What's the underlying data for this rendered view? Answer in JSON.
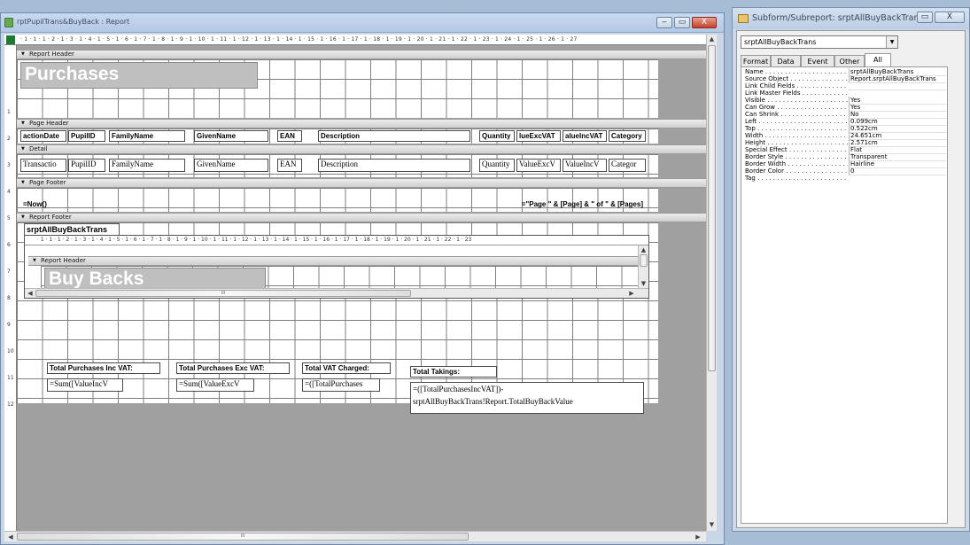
{
  "report_window": {
    "title": "rptPupilTrans&BuyBack : Report",
    "controls": {
      "minimize": "‒",
      "restore": "▭",
      "close": "X"
    },
    "ruler_ticks": "· 1 · 1 · 1 · 2 · 1 · 3 · 1 · 4 · 1 · 5 · 1 · 6 · 1 · 7 · 1 · 8 · 1 · 9 · 1 · 10 · 1 · 11 · 1 · 12 · 1 · 13 · 1 · 14 · 1 · 15 · 1 · 16 · 1 · 17 · 1 · 18 · 1 · 19 · 1 · 20 · 1 · 21 · 1 · 22 · 1 · 23 · 1 · 24 · 1 · 25 · 1 · 26 · 1 · 27",
    "sub_ruler_ticks": "· 1 · 1 · 1 · 2 · 1 · 3 · 1 · 4 · 1 · 5 · 1 · 6 · 1 · 7 · 1 · 8 · 1 · 9 · 1 · 10 · 1 · 11 · 1 · 12 · 1 · 13 · 1 · 14 · 1 · 15 · 1 · 16 · 1 · 17 · 1 · 18 · 1 · 19 · 1 · 20 · 1 · 21 · 1 · 22 · 1 · 23",
    "left_ruler": [
      "1",
      "2",
      "3",
      "4",
      "5",
      "6",
      "7",
      "8",
      "9",
      "10",
      "11",
      "12"
    ],
    "bands": {
      "report_header": "Report Header",
      "page_header": "Page Header",
      "detail": "Detail",
      "page_footer": "Page Footer",
      "report_footer": "Report Footer"
    },
    "report_header_title": "Purchases",
    "page_header_labels": [
      "actionDate",
      "PupilID",
      "FamilyName",
      "GivenName",
      "EAN",
      "Description",
      "Quantity",
      "lueExcVAT",
      "alueIncVAT",
      "Category"
    ],
    "detail_fields": [
      "Transactio",
      "PupilID",
      "FamilyName",
      "GivenName",
      "EAN",
      "Description",
      "Quantity",
      "ValueExcV",
      "ValueIncV",
      "Categor"
    ],
    "page_footer": {
      "left": "=Now()",
      "right": "=\"Page \" & [Page] & \" of \" & [Pages]"
    },
    "subreport": {
      "name": "srptAllBuyBackTrans",
      "band": "Report Header",
      "title": "Buy Backs",
      "hscroll_marker": "III"
    },
    "footer_labels": {
      "inc_vat": "Total Purchases Inc VAT:",
      "exc_vat": "Total Purchases Exc VAT:",
      "vat": "Total VAT Charged:",
      "takings": "Total Takings:"
    },
    "footer_fields": {
      "inc_vat": "=Sum([ValueIncV",
      "exc_vat": "=Sum([ValueExcV",
      "vat": "=([TotalPurchases",
      "takings_line1": "=([TotalPurchasesIncVAT])-",
      "takings_line2": "srptAllBuyBackTrans!Report.TotalBuyBackValue"
    },
    "hscroll_marker": "III"
  },
  "property_sheet": {
    "title": "Subform/Subreport: srptAllBuyBackTrans",
    "controls": {
      "restore": "▭",
      "close": "X"
    },
    "object": "srptAllBuyBackTrans",
    "tabs": [
      "Format",
      "Data",
      "Event",
      "Other",
      "All"
    ],
    "active_tab": "All",
    "properties": [
      {
        "name": "Name",
        "value": "srptAllBuyBackTrans"
      },
      {
        "name": "Source Object",
        "value": "Report.srptAllBuyBackTrans"
      },
      {
        "name": "Link Child Fields",
        "value": ""
      },
      {
        "name": "Link Master Fields",
        "value": ""
      },
      {
        "name": "Visible",
        "value": "Yes"
      },
      {
        "name": "Can Grow",
        "value": "Yes"
      },
      {
        "name": "Can Shrink",
        "value": "No"
      },
      {
        "name": "Left",
        "value": "0.099cm"
      },
      {
        "name": "Top",
        "value": "0.522cm"
      },
      {
        "name": "Width",
        "value": "24.651cm"
      },
      {
        "name": "Height",
        "value": "2.571cm"
      },
      {
        "name": "Special Effect",
        "value": "Flat"
      },
      {
        "name": "Border Style",
        "value": "Transparent"
      },
      {
        "name": "Border Width",
        "value": "Hairline"
      },
      {
        "name": "Border Color",
        "value": "0"
      },
      {
        "name": "Tag",
        "value": ""
      }
    ]
  }
}
